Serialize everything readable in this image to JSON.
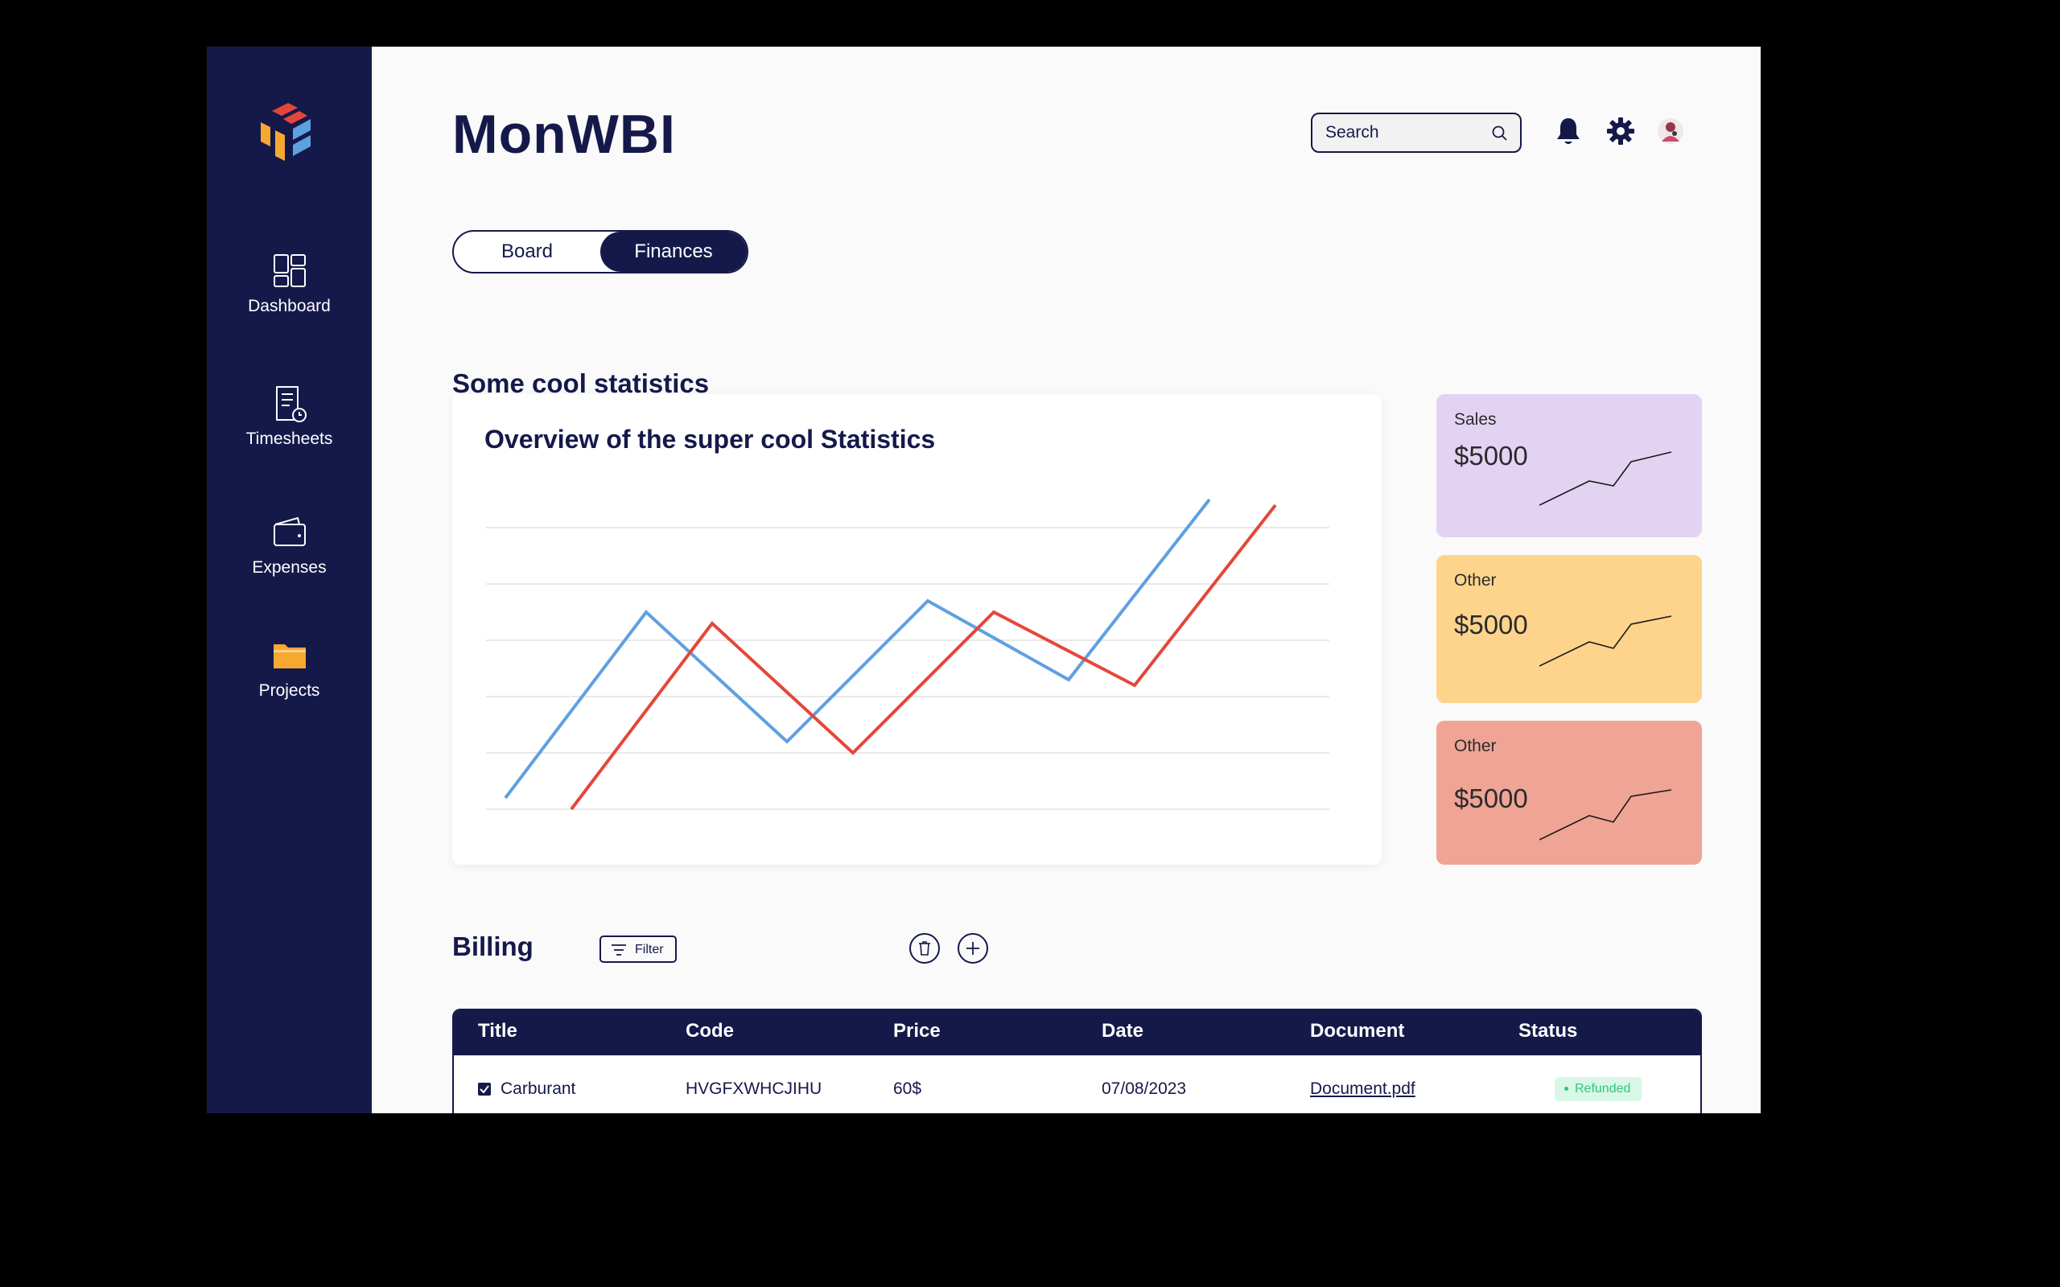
{
  "app": {
    "title": "MonWBI"
  },
  "header": {
    "search_placeholder": "Search",
    "icons": [
      "search-icon",
      "bell-icon",
      "gear-icon",
      "avatar"
    ]
  },
  "sidebar": {
    "items": [
      {
        "label": "Dashboard",
        "icon": "dashboard-icon"
      },
      {
        "label": "Timesheets",
        "icon": "timesheet-icon"
      },
      {
        "label": "Expenses",
        "icon": "wallet-icon"
      },
      {
        "label": "Projects",
        "icon": "folder-icon"
      }
    ]
  },
  "tabs": [
    {
      "label": "Board",
      "active": false
    },
    {
      "label": "Finances",
      "active": true
    }
  ],
  "section_title": "Some cool statistics",
  "chart_data": {
    "type": "line",
    "title": "Overview of the super cool Statistics",
    "xlabel": "",
    "ylabel": "",
    "grid": true,
    "x": [
      0,
      1,
      2,
      3,
      4,
      5,
      6
    ],
    "ylim": [
      0,
      5
    ],
    "series": [
      {
        "color": "#5fa0e0",
        "values": [
          0.2,
          3.5,
          1.2,
          3.7,
          2.3,
          5.5
        ]
      },
      {
        "color": "#e4473a",
        "values": [
          0.0,
          3.3,
          1.0,
          3.5,
          2.2,
          5.4
        ]
      }
    ]
  },
  "stat_cards": [
    {
      "label": "Sales",
      "value": "$5000",
      "color": "#e3d3f3"
    },
    {
      "label": "Other",
      "value": "$5000",
      "color": "#fed48d"
    },
    {
      "label": "Other",
      "value": "$5000",
      "color": "#f0a496"
    }
  ],
  "billing": {
    "title": "Billing",
    "filter_label": "Filter",
    "columns": [
      "Title",
      "Code",
      "Price",
      "Date",
      "Document",
      "Status"
    ],
    "rows": [
      {
        "checked": true,
        "title": "Carburant",
        "code": "HVGFXWHCJIHU",
        "price": "60$",
        "date": "07/08/2023",
        "document": "Document.pdf",
        "status": "Refunded"
      }
    ]
  },
  "colors": {
    "navy": "#15194a",
    "chart_blue": "#5fa0e0",
    "chart_red": "#e4473a",
    "status_green": "#2ec77a"
  }
}
